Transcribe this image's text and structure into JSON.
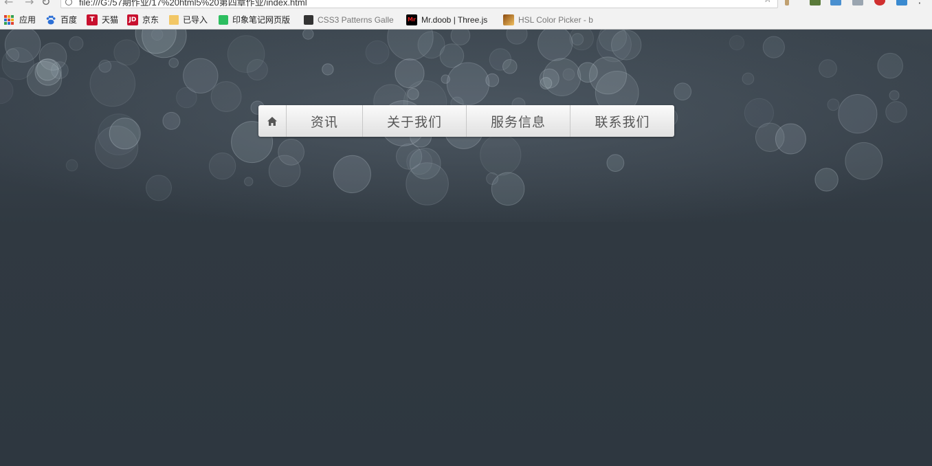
{
  "browser": {
    "url": "file:///G:/57期作业/17%20html5%20第四章作业/index.html",
    "bookmarks": [
      {
        "label": "应用",
        "icon": "apps-grid-icon"
      },
      {
        "label": "百度",
        "icon": "baidu-paw-icon",
        "color": "#2b6fd6"
      },
      {
        "label": "天猫",
        "icon": "tmall-icon",
        "color": "#c8102e",
        "glyph": "T"
      },
      {
        "label": "京东",
        "icon": "jd-icon",
        "color": "#c8102e",
        "glyph": "JD"
      },
      {
        "label": "已导入",
        "icon": "folder-icon",
        "color": "#f2c766"
      },
      {
        "label": "印象笔记网页版",
        "icon": "evernote-icon",
        "color": "#2dbe60"
      },
      {
        "label": "CSS3 Patterns Galle",
        "icon": "css3-patterns-icon",
        "color": "#333333"
      },
      {
        "label": "Mr.doob | Three.js",
        "icon": "mrdoob-icon",
        "color": "#000000",
        "glyph": "Mr"
      },
      {
        "label": "HSL Color Picker - b",
        "icon": "hsl-picker-icon",
        "color": "#c98a2b"
      }
    ]
  },
  "nav": {
    "items": [
      {
        "label": "资讯"
      },
      {
        "label": "关于我们"
      },
      {
        "label": "服务信息"
      },
      {
        "label": "联系我们"
      }
    ]
  },
  "colors": {
    "background": "#2f3840",
    "nav_bg": "#ececec",
    "nav_text": "#555555"
  }
}
